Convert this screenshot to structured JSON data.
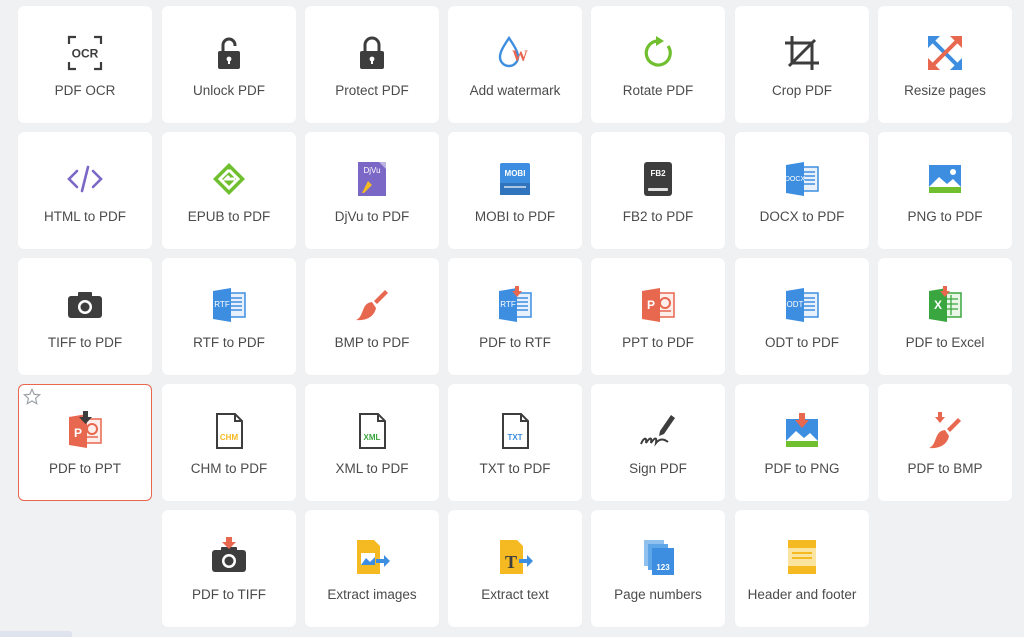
{
  "tiles": [
    {
      "label": "PDF OCR",
      "icon": "ocr-icon"
    },
    {
      "label": "Unlock PDF",
      "icon": "unlock-icon"
    },
    {
      "label": "Protect PDF",
      "icon": "lock-icon"
    },
    {
      "label": "Add watermark",
      "icon": "watermark-icon"
    },
    {
      "label": "Rotate PDF",
      "icon": "rotate-icon"
    },
    {
      "label": "Crop PDF",
      "icon": "crop-icon"
    },
    {
      "label": "Resize pages",
      "icon": "resize-icon"
    },
    {
      "label": "HTML to PDF",
      "icon": "code-icon"
    },
    {
      "label": "EPUB to PDF",
      "icon": "epub-icon"
    },
    {
      "label": "DjVu to PDF",
      "icon": "djvu-icon"
    },
    {
      "label": "MOBI to PDF",
      "icon": "mobi-icon"
    },
    {
      "label": "FB2 to PDF",
      "icon": "fb2-icon"
    },
    {
      "label": "DOCX to PDF",
      "icon": "docx-icon"
    },
    {
      "label": "PNG to PDF",
      "icon": "image-icon"
    },
    {
      "label": "TIFF to PDF",
      "icon": "camera-icon"
    },
    {
      "label": "RTF to PDF",
      "icon": "rtf-icon"
    },
    {
      "label": "BMP to PDF",
      "icon": "brush-icon"
    },
    {
      "label": "PDF to RTF",
      "icon": "rtf-download-icon"
    },
    {
      "label": "PPT to PDF",
      "icon": "ppt-icon"
    },
    {
      "label": "ODT to PDF",
      "icon": "odt-icon"
    },
    {
      "label": "PDF to Excel",
      "icon": "excel-icon"
    },
    {
      "label": "PDF to PPT",
      "icon": "ppt-download-icon",
      "selected": true
    },
    {
      "label": "CHM to PDF",
      "icon": "chm-file-icon"
    },
    {
      "label": "XML to PDF",
      "icon": "xml-file-icon"
    },
    {
      "label": "TXT to PDF",
      "icon": "txt-file-icon"
    },
    {
      "label": "Sign PDF",
      "icon": "pen-signature-icon"
    },
    {
      "label": "PDF to PNG",
      "icon": "image-download-icon"
    },
    {
      "label": "PDF to BMP",
      "icon": "brush-download-icon"
    },
    {
      "label": "PDF to TIFF",
      "icon": "camera-download-icon"
    },
    {
      "label": "Extract images",
      "icon": "extract-images-icon"
    },
    {
      "label": "Extract text",
      "icon": "extract-text-icon"
    },
    {
      "label": "Page numbers",
      "icon": "page-numbers-icon"
    },
    {
      "label": "Header and footer",
      "icon": "header-footer-icon"
    }
  ],
  "icon_text": {
    "ocr": "OCR",
    "djvu": "DjVu",
    "mobi": "MOBI",
    "fb2": "FB2",
    "docx": "DOCX",
    "rtf": "RTF",
    "odt": "ODT",
    "ppt": "P",
    "excel": "X",
    "chm": "CHM",
    "xml": "XML",
    "txt": "TXT",
    "page": "123",
    "text_t": "T",
    "watermark": "W"
  },
  "colors": {
    "selected_border": "#e8674f",
    "label": "#4b4b4b",
    "dark": "#3d3d3d",
    "blue": "#3d8ee0",
    "green": "#6fbf2f",
    "orange": "#e8674f",
    "purple": "#7b68c6",
    "yellow": "#f5b921",
    "excel_green": "#3aa63f"
  }
}
